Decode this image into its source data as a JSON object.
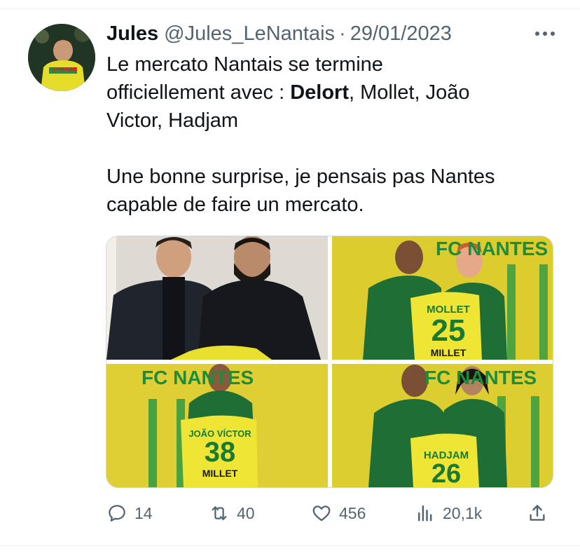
{
  "tweet": {
    "author_name": "Jules",
    "handle": "@Jules_LeNantais",
    "separator": "·",
    "date": "29/01/2023",
    "text_before_bold": "Le mercato Nantais se termine\nofficiellement avec : ",
    "text_bold": "Delort",
    "text_after_bold": ", Mollet, João\nVictor, Hadjam\n\nUne bonne surprise, je pensais pas Nantes\ncapable de faire un mercato.",
    "avatar_shirt_text": "SYNERGIE"
  },
  "media": {
    "tiles": [
      {
        "description_icon": "photo-delort"
      },
      {
        "banner": "FC NANTES",
        "shirt_name": "MOLLET",
        "shirt_number": "25",
        "sponsor": "MILLET"
      },
      {
        "banner": "FC NANTES",
        "shirt_name": "JOÃO VÍCTOR",
        "shirt_number": "38",
        "sponsor": "MILLET"
      },
      {
        "banner": "FC NANTES",
        "shirt_name": "HADJAM",
        "shirt_number": "26"
      }
    ]
  },
  "actions": {
    "replies": "14",
    "retweets": "40",
    "likes": "456",
    "views": "20,1k"
  },
  "colors": {
    "muted_text": "#536471",
    "nantes_yellow": "#e0cf34",
    "nantes_green": "#1e8c3c"
  }
}
